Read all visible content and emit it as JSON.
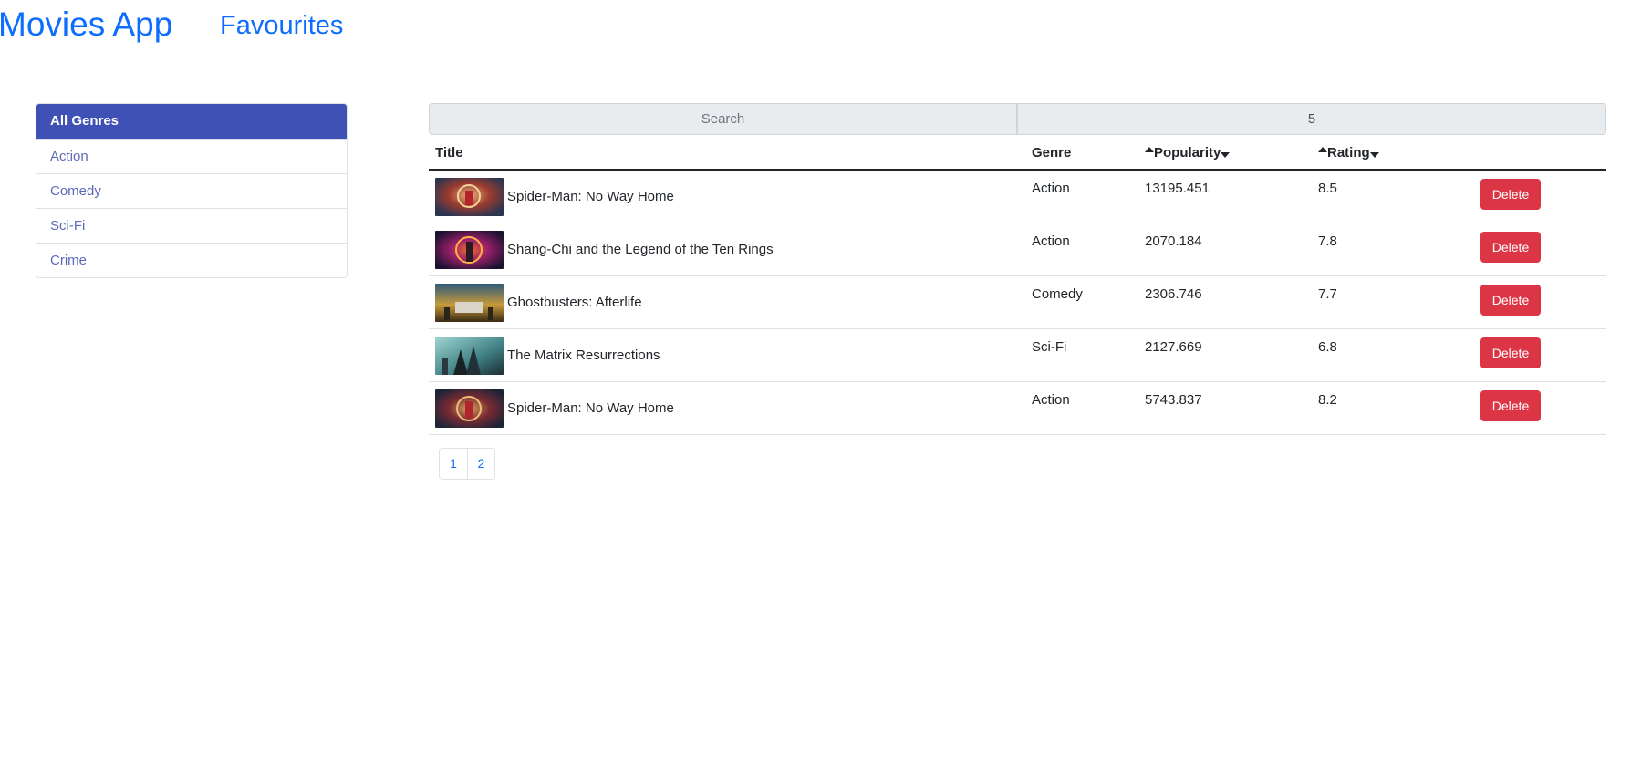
{
  "navbar": {
    "brand": "Movies App",
    "favourites_link": "Favourites"
  },
  "genres": {
    "items": [
      "All Genres",
      "Action",
      "Comedy",
      "Sci-Fi",
      "Crime"
    ],
    "active": "All Genres"
  },
  "controls": {
    "search_placeholder": "Search",
    "page_size": "5"
  },
  "table": {
    "headers": {
      "title": "Title",
      "genre": "Genre",
      "popularity": "Popularity",
      "rating": "Rating"
    },
    "delete_label": "Delete",
    "rows": [
      {
        "title": "Spider-Man: No Way Home",
        "genre": "Action",
        "popularity": "13195.451",
        "rating": "8.5",
        "poster": "spider-man-poster"
      },
      {
        "title": "Shang-Chi and the Legend of the Ten Rings",
        "genre": "Action",
        "popularity": "2070.184",
        "rating": "7.8",
        "poster": "shang-chi-poster"
      },
      {
        "title": "Ghostbusters: Afterlife",
        "genre": "Comedy",
        "popularity": "2306.746",
        "rating": "7.7",
        "poster": "ghostbusters-poster"
      },
      {
        "title": "The Matrix Resurrections",
        "genre": "Sci-Fi",
        "popularity": "2127.669",
        "rating": "6.8",
        "poster": "matrix-poster"
      },
      {
        "title": "Spider-Man: No Way Home",
        "genre": "Action",
        "popularity": "5743.837",
        "rating": "8.2",
        "poster": "spider-man-poster"
      }
    ]
  },
  "pagination": {
    "pages": [
      "1",
      "2"
    ]
  },
  "colors": {
    "link": "#0d6efd",
    "active_genre": "#3f51b5",
    "delete": "#dc3545"
  }
}
